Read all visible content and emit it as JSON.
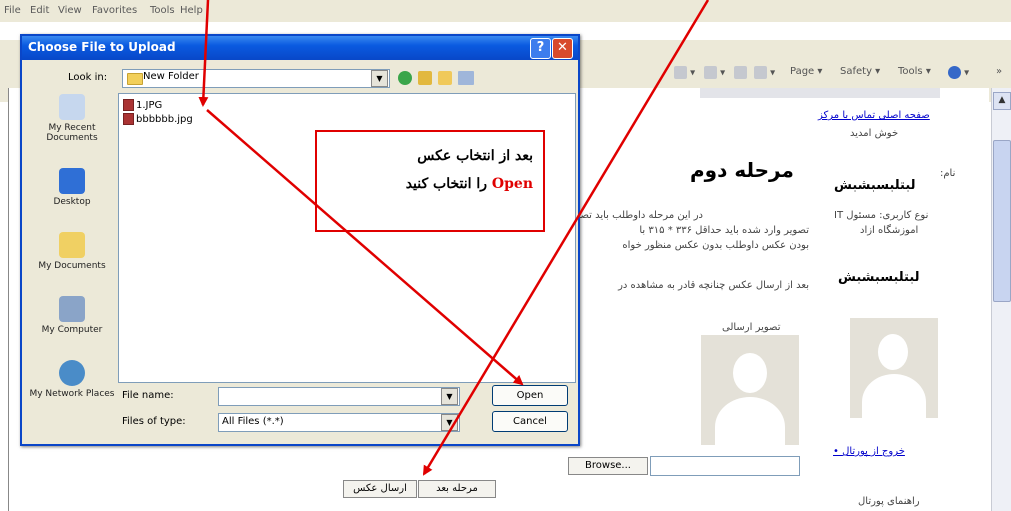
{
  "browser": {
    "menu": [
      "File",
      "Edit",
      "View",
      "Favorites",
      "Tools",
      "Help"
    ],
    "command_bar": {
      "page_label": "Page ▾",
      "safety_label": "Safety ▾",
      "tools_label": "Tools ▾",
      "more_label": "»"
    }
  },
  "dialog": {
    "title": "Choose File to Upload",
    "help_glyph": "?",
    "close_glyph": "✕",
    "look_in_label": "Look in:",
    "look_in_value": "New Folder",
    "places": [
      "My Recent Documents",
      "Desktop",
      "My Documents",
      "My Computer",
      "My Network Places"
    ],
    "files": [
      "1.JPG",
      "bbbbbb.jpg"
    ],
    "file_name_label": "File name:",
    "file_name_value": "",
    "file_type_label": "Files of type:",
    "file_type_value": "All Files (*.*)",
    "open_label": "Open",
    "cancel_label": "Cancel"
  },
  "callout": {
    "line1": "بعد از انتخاب عکس",
    "open_word": "Open",
    "line2_rest": " را انتخاب کنید"
  },
  "page": {
    "nav_links": "صفحه اصلی  تماس با مرکز",
    "welcome": "خوش امدید",
    "heading": "مرحله دوم",
    "name_label": "نام:",
    "name_value": "لبتلبسبشبش",
    "info_line1": "نوع کاربری: مسئول IT",
    "info_line2": "اموزشگاه ازاد",
    "user_name": "لبتلبسبشبش",
    "para_1": "در این مرحله داوطلب باید تصویر خود را ",
    "para_2": "تصویر وارد شده باید حداقل ۳۳۶ * ۳۱۵ با ",
    "para_3": "بودن عکس داوطلب بدون عکس منظور خواه",
    "para_4": "بعد از ارسال عکس چنانچه قادر به مشاهده در",
    "photo_label": "تصویر ارسالی",
    "logout_link": "خروج از پورتال",
    "portal_guide": "راهنمای پورتال",
    "browse_label": "Browse...",
    "next_step_label": "مرحله بعد",
    "send_photo_label": "ارسال عکس"
  },
  "colors": {
    "title_bar": "#0a5ae0",
    "annotation_red": "#e00000",
    "dialog_face": "#ece9d8",
    "link_blue": "#0000cc"
  }
}
